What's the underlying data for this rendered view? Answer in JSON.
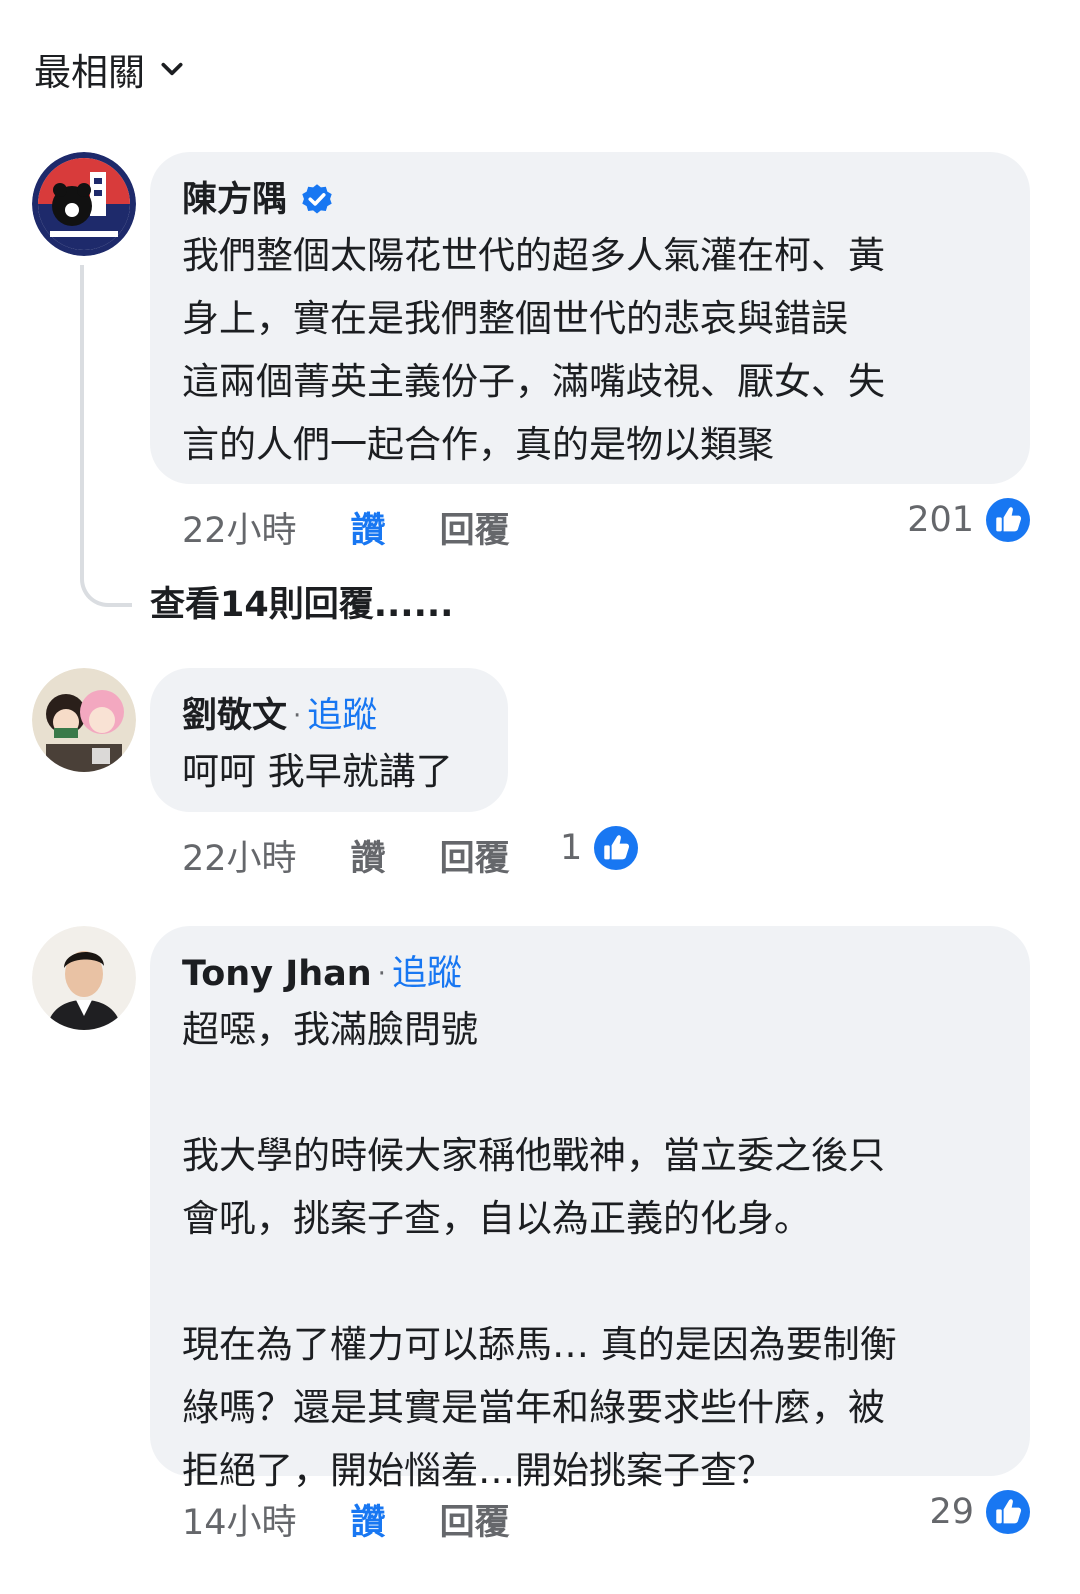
{
  "sort": {
    "label": "最相關"
  },
  "comments": [
    {
      "author": "陳方隅",
      "verified": true,
      "follow_label": "",
      "text": "我們整個太陽花世代的超多人氣灌在柯、黃\n身上，實在是我們整個世代的悲哀與錯誤\n這兩個菁英主義份子，滿嘴歧視、厭女、失\n言的人們一起合作，真的是物以類聚",
      "time": "22小時",
      "like_label": "讚",
      "reply_label": "回覆",
      "reaction_count": "201"
    },
    {
      "author": "劉敬文",
      "verified": false,
      "follow_label": "追蹤",
      "text": "呵呵 我早就講了",
      "time": "22小時",
      "like_label": "讚",
      "reply_label": "回覆",
      "reaction_count": "1"
    },
    {
      "author": "Tony Jhan",
      "verified": false,
      "follow_label": "追蹤",
      "text": "超噁，我滿臉問號\n\n我大學的時候大家稱他戰神，當立委之後只\n會吼，挑案子查，自以為正義的化身。\n\n現在為了權力可以舔馬… 真的是因為要制衡\n綠嗎？還是其實是當年和綠要求些什麼，被\n拒絕了，開始惱羞…開始挑案子查？",
      "time": "14小時",
      "like_label": "讚",
      "reply_label": "回覆",
      "reaction_count": "29"
    }
  ],
  "view_replies": "查看14則回覆......",
  "colors": {
    "accent": "#1877f2",
    "bubble": "#f0f2f5",
    "muted": "#65676b"
  }
}
